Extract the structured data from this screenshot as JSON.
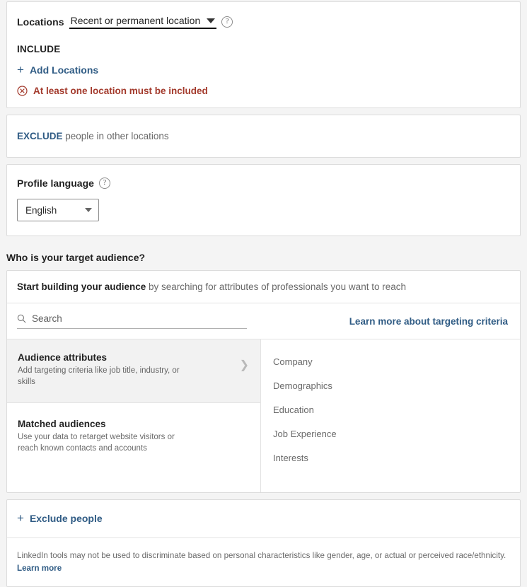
{
  "locations": {
    "label": "Locations",
    "dropdown_value": "Recent or permanent location",
    "help_icon": "question-circle-icon",
    "caret_icon": "caret-down-icon",
    "include_label": "INCLUDE",
    "add_locations_label": "Add Locations",
    "add_icon": "plus-icon",
    "error_icon": "error-circle-x-icon",
    "error_text": "At least one location must be included",
    "error_color": "#a33a2c",
    "link_color": "#2f5b84"
  },
  "exclude_locations": {
    "strong": "EXCLUDE",
    "rest": " people in other locations"
  },
  "profile_language": {
    "title": "Profile language",
    "help_icon": "question-circle-icon",
    "selected": "English",
    "caret_icon": "caret-down-icon"
  },
  "audience_section": {
    "heading": "Who is your target audience?",
    "start_building_strong": "Start building your audience",
    "start_building_rest": " by searching for attributes of professionals you want to reach",
    "search": {
      "icon": "search-icon",
      "placeholder": "Search",
      "value": ""
    },
    "learn_more_label": "Learn more about targeting criteria",
    "options": [
      {
        "title": "Audience attributes",
        "desc": "Add targeting criteria like job title, industry, or skills",
        "chevron_icon": "chevron-right-icon",
        "active": true
      },
      {
        "title": "Matched audiences",
        "desc": "Use your data to retarget website visitors or reach known contacts and accounts",
        "active": false
      }
    ],
    "categories": [
      "Company",
      "Demographics",
      "Education",
      "Job Experience",
      "Interests"
    ]
  },
  "exclude_people": {
    "label": "Exclude people",
    "add_icon": "plus-icon",
    "disclaimer_text": "LinkedIn tools may not be used to discriminate based on personal characteristics like gender, age, or actual or perceived race/ethnicity. ",
    "disclaimer_link": "Learn more"
  }
}
